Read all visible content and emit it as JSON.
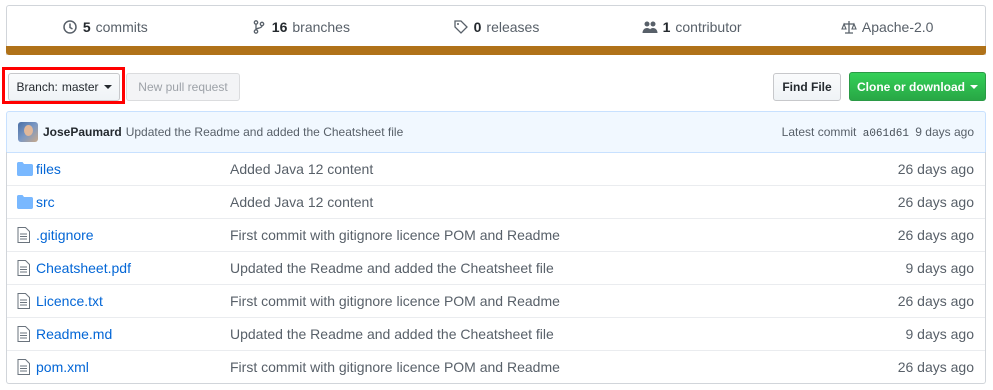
{
  "summary": {
    "commits_count": "5",
    "commits_label": "commits",
    "branches_count": "16",
    "branches_label": "branches",
    "releases_count": "0",
    "releases_label": "releases",
    "contributors_count": "1",
    "contributors_label": "contributor",
    "license": "Apache-2.0",
    "language_bar_color": "#b07219"
  },
  "toolbar": {
    "branch_prefix": "Branch:",
    "branch_name": "master",
    "new_pr_label": "New pull request",
    "find_file_label": "Find File",
    "clone_label": "Clone or download"
  },
  "commit": {
    "author": "JosePaumard",
    "message": "Updated the Readme and added the Cheatsheet file",
    "latest_label": "Latest commit",
    "sha": "a061d61",
    "age": "9 days ago"
  },
  "files": [
    {
      "name": "files",
      "type": "folder",
      "message": "Added Java 12 content",
      "age": "26 days ago"
    },
    {
      "name": "src",
      "type": "folder",
      "message": "Added Java 12 content",
      "age": "26 days ago"
    },
    {
      "name": ".gitignore",
      "type": "file",
      "message": "First commit with gitignore licence POM and Readme",
      "age": "26 days ago"
    },
    {
      "name": "Cheatsheet.pdf",
      "type": "file",
      "message": "Updated the Readme and added the Cheatsheet file",
      "age": "9 days ago"
    },
    {
      "name": "Licence.txt",
      "type": "file",
      "message": "First commit with gitignore licence POM and Readme",
      "age": "26 days ago"
    },
    {
      "name": "Readme.md",
      "type": "file",
      "message": "Updated the Readme and added the Cheatsheet file",
      "age": "9 days ago"
    },
    {
      "name": "pom.xml",
      "type": "file",
      "message": "First commit with gitignore licence POM and Readme",
      "age": "26 days ago"
    }
  ],
  "colors": {
    "link": "#0366d6",
    "green_button": "#28a745",
    "highlight": "#ff0000"
  }
}
